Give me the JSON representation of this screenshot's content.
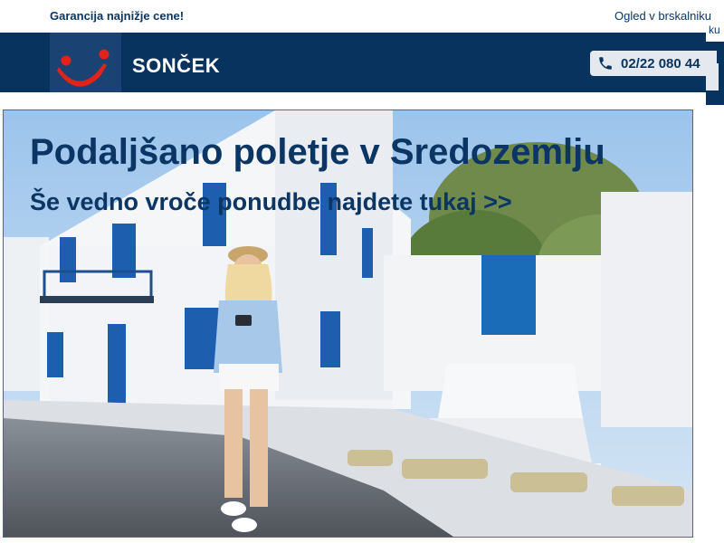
{
  "topbar": {
    "guarantee_text": "Garancija najnižje cene!",
    "browser_link": "Ogled v brskalniku",
    "overflow_text": "ku"
  },
  "header": {
    "brand_name": "SONČEK",
    "phone_number": "02/22 080 44"
  },
  "banner": {
    "headline": "Podaljšano poletje v Sredozemlju",
    "subline": "Še vedno vroče ponudbe najdete tukaj >>"
  },
  "colors": {
    "navy": "#09335f",
    "logo_red": "#e2231a",
    "banner_border": "#2f6fb4",
    "shutter_blue": "#1d5fae"
  }
}
